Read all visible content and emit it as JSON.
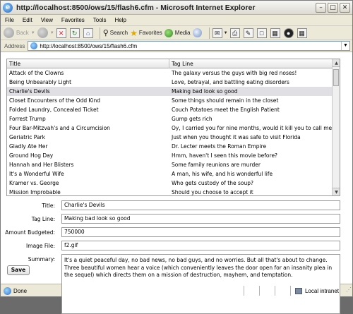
{
  "window": {
    "title": "http://localhost:8500/ows/15/flash6.cfm - Microsoft Internet Explorer"
  },
  "menu": [
    "File",
    "Edit",
    "View",
    "Favorites",
    "Tools",
    "Help"
  ],
  "toolbar": {
    "back_label": "Back",
    "search_label": "Search",
    "favorites_label": "Favorites",
    "media_label": "Media"
  },
  "address": {
    "label": "Address",
    "url": "http://localhost:8500/ows/15/flash6.cfm"
  },
  "grid": {
    "columns": [
      "Title",
      "Tag Line"
    ],
    "selected_index": 2,
    "rows": [
      [
        "Attack of the Clowns",
        "The galaxy versus the guys with big red noses!"
      ],
      [
        "Being Unbearably Light",
        "Love, betrayal, and battling eating disorders"
      ],
      [
        "Charlie's Devils",
        "Making bad look so good"
      ],
      [
        "Closet Encounters of the Odd Kind",
        "Some things should remain in the closet"
      ],
      [
        "Folded Laundry, Concealed Ticket",
        "Couch Potatoes meet the English Patient"
      ],
      [
        "Forrest Trump",
        "Gump gets rich"
      ],
      [
        "Four Bar-Mitzvah's and a Circumcision",
        "Oy, I carried you for nine months, would it kill you to call me once in"
      ],
      [
        "Geriatric Park",
        "Just when you thought it was safe to visit Florida"
      ],
      [
        "Gladly Ate Her",
        "Dr. Lecter meets the Roman Empire"
      ],
      [
        "Ground Hog Day",
        "Hmm, haven't I seen this movie before?"
      ],
      [
        "Hannah and Her Blisters",
        "Some family reunions are murder"
      ],
      [
        "It's a Wonderful Wife",
        "A man, his wife, and his wonderful life"
      ],
      [
        "Kramer vs. George",
        "Who gets custody of the soup?"
      ],
      [
        "Mission Improbable",
        "Should you choose to accept it"
      ]
    ]
  },
  "form": {
    "title_label": "Title:",
    "title_value": "Charlie's Devils",
    "tagline_label": "Tag Line:",
    "tagline_value": "Making bad look so good",
    "budget_label": "Amount Budgeted:",
    "budget_value": "750000",
    "image_label": "Image File:",
    "image_value": "f2.gif",
    "summary_label": "Summary:",
    "summary_value": "It's a quiet peaceful day, no bad news, no bad guys, and no worries. But all that's about to change. Three beautiful women hear a voice (which conveniently leaves the door open for an insanity plea in the sequel) which directs them on a mission of destruction, mayhem, and temptation.",
    "save_label": "Save"
  },
  "status": {
    "text": "Done",
    "zone": "Local intranet"
  }
}
